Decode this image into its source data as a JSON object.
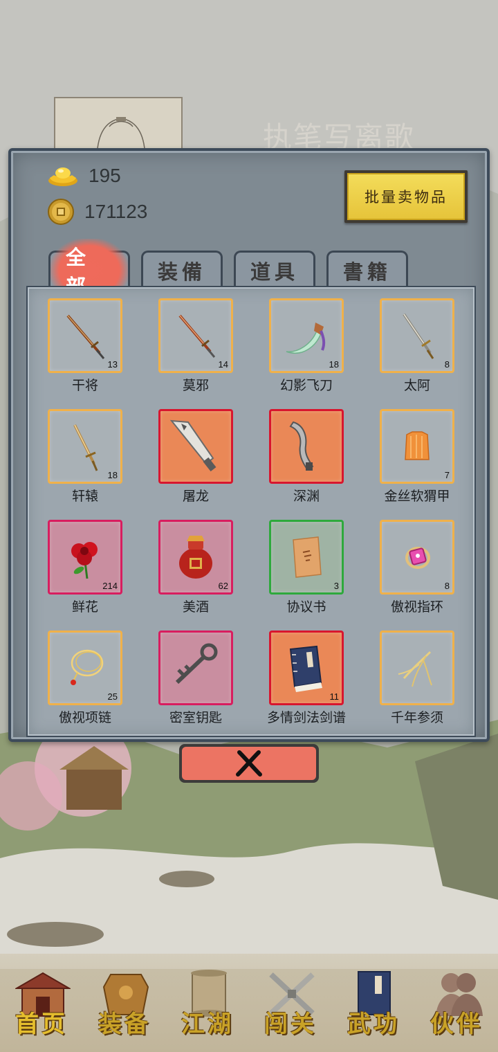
{
  "player": {
    "name": "执笔写离歌"
  },
  "currency": {
    "gold_icon": "gold-ingot-icon",
    "gold": "195",
    "coin_icon": "copper-coin-icon",
    "coins": "171123"
  },
  "actions": {
    "sell_bulk_label": "批量卖物品"
  },
  "tabs": [
    {
      "label": "全部",
      "active": true
    },
    {
      "label": "装備",
      "active": false
    },
    {
      "label": "道具",
      "active": false
    },
    {
      "label": "書籍",
      "active": false
    }
  ],
  "items": [
    {
      "name": "干将",
      "count": "13",
      "icon": "sword-icon",
      "quality_color": "#f0b14a"
    },
    {
      "name": "莫邪",
      "count": "14",
      "icon": "sword-icon",
      "quality_color": "#f0b14a"
    },
    {
      "name": "幻影飞刀",
      "count": "18",
      "icon": "flying-knife-icon",
      "quality_color": "#f0b14a"
    },
    {
      "name": "太阿",
      "count": "8",
      "icon": "sword-icon",
      "quality_color": "#f0b14a"
    },
    {
      "name": "轩辕",
      "count": "18",
      "icon": "sword-icon",
      "quality_color": "#f0b14a"
    },
    {
      "name": "屠龙",
      "count": "",
      "icon": "broadsword-icon",
      "quality_color": "#d8162e"
    },
    {
      "name": "深渊",
      "count": "",
      "icon": "saber-icon",
      "quality_color": "#d8162e"
    },
    {
      "name": "金丝软猬甲",
      "count": "7",
      "icon": "armor-vest-icon",
      "quality_color": "#f0b14a"
    },
    {
      "name": "鲜花",
      "count": "214",
      "icon": "rose-icon",
      "quality_color": "#d81d5f"
    },
    {
      "name": "美酒",
      "count": "62",
      "icon": "wine-jar-icon",
      "quality_color": "#d81d5f"
    },
    {
      "name": "协议书",
      "count": "3",
      "icon": "scroll-document-icon",
      "quality_color": "#2ea93c"
    },
    {
      "name": "傲视指环",
      "count": "8",
      "icon": "ring-icon",
      "quality_color": "#f0b14a"
    },
    {
      "name": "傲视项链",
      "count": "25",
      "icon": "necklace-icon",
      "quality_color": "#f0b14a"
    },
    {
      "name": "密室钥匙",
      "count": "",
      "icon": "key-icon",
      "quality_color": "#d81d5f"
    },
    {
      "name": "多情剑法剑谱",
      "count": "11",
      "icon": "manual-book-icon",
      "quality_color": "#d8162e"
    },
    {
      "name": "千年参须",
      "count": "",
      "icon": "ginseng-root-icon",
      "quality_color": "#f0b14a"
    }
  ],
  "close_icon": "close-x-icon",
  "bottom_nav": [
    {
      "label": "首页",
      "icon": "house-icon",
      "active": true
    },
    {
      "label": "装备",
      "icon": "armor-icon",
      "active": false
    },
    {
      "label": "江湖",
      "icon": "scroll-map-icon",
      "active": false
    },
    {
      "label": "闯关",
      "icon": "crossed-swords-icon",
      "active": false
    },
    {
      "label": "武功",
      "icon": "martial-book-icon",
      "active": false
    },
    {
      "label": "伙伴",
      "icon": "companions-icon",
      "active": false
    }
  ]
}
